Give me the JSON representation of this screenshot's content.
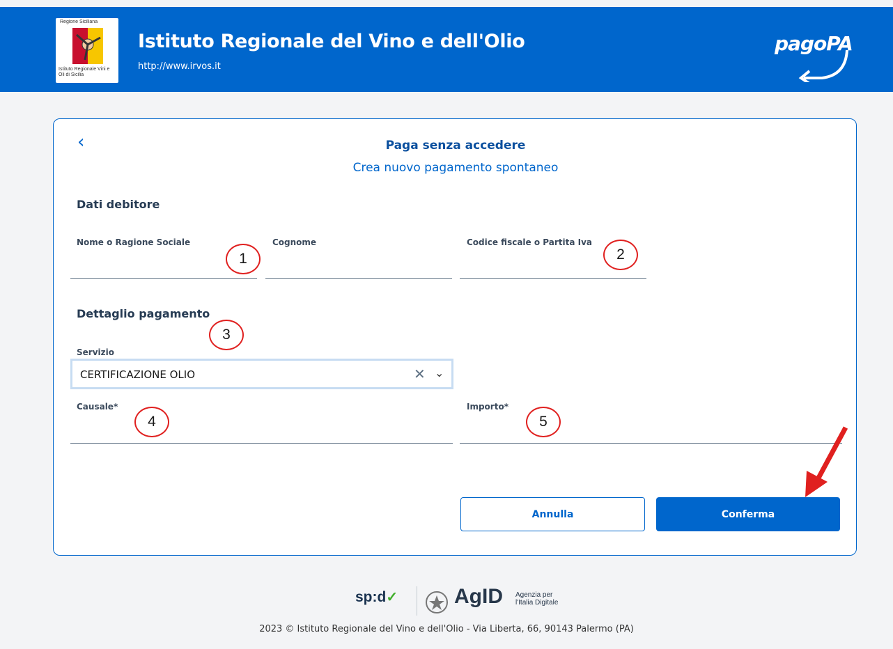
{
  "header": {
    "logo_top_text": "Regione Siciliana",
    "logo_bottom_text": "Istituto Regionale Vini e Oli di Sicilia",
    "title": "Istituto Regionale del Vino e dell'Olio",
    "url": "http://www.irvos.it",
    "pagopa_label": "pagoPA"
  },
  "card": {
    "title": "Paga senza accedere",
    "subtitle": "Crea nuovo pagamento spontaneo",
    "debtor_section": "Dati debitore",
    "name_label": "Nome o Ragione Sociale",
    "surname_label": "Cognome",
    "fiscal_code_label": "Codice fiscale o Partita Iva",
    "payment_section": "Dettaglio pagamento",
    "service_label": "Servizio",
    "service_value": "CERTIFICAZIONE OLIO",
    "reason_label": "Causale*",
    "amount_label": "Importo*",
    "cancel_label": "Annulla",
    "confirm_label": "Conferma"
  },
  "annotations": [
    "1",
    "2",
    "3",
    "4",
    "5"
  ],
  "colors": {
    "primary": "#0066cc",
    "annotation": "#e0201f"
  },
  "footer": {
    "spid_label": "sp:d",
    "agid_label": "AgID",
    "agid_sub": "Agenzia per l'Italia Digitale",
    "copyright": "2023 © Istituto Regionale del Vino e dell'Olio - Via Liberta, 66, 90143 Palermo (PA)"
  }
}
